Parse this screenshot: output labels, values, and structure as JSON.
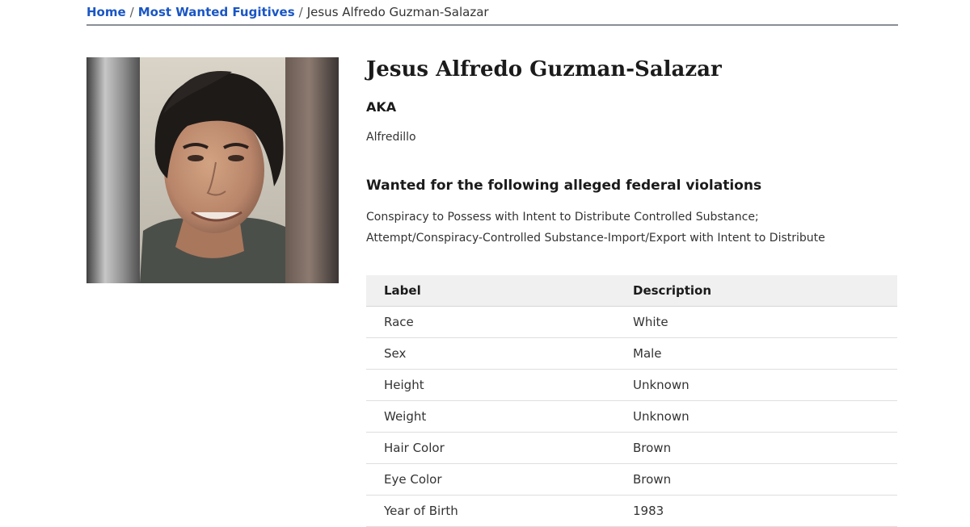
{
  "breadcrumb": {
    "home": "Home",
    "section": "Most Wanted Fugitives",
    "current": "Jesus Alfredo Guzman-Salazar",
    "separator": "/"
  },
  "profile": {
    "name": "Jesus Alfredo Guzman-Salazar",
    "aka_heading": "AKA",
    "aka_value": "Alfredillo",
    "wanted_heading": "Wanted for the following alleged federal violations",
    "violations": [
      "Conspiracy to Possess with Intent to Distribute Controlled Substance;",
      "Attempt/Conspiracy-Controlled Substance-Import/Export with Intent to Distribute"
    ]
  },
  "details_table": {
    "headers": [
      "Label",
      "Description"
    ],
    "rows": [
      [
        "Race",
        "White"
      ],
      [
        "Sex",
        "Male"
      ],
      [
        "Height",
        "Unknown"
      ],
      [
        "Weight",
        "Unknown"
      ],
      [
        "Hair Color",
        "Brown"
      ],
      [
        "Eye Color",
        "Brown"
      ],
      [
        "Year of Birth",
        "1983"
      ]
    ]
  },
  "colors": {
    "link": "#1a56c4",
    "table_header_bg": "#f0f0f0",
    "divider": "#8a8f96"
  }
}
